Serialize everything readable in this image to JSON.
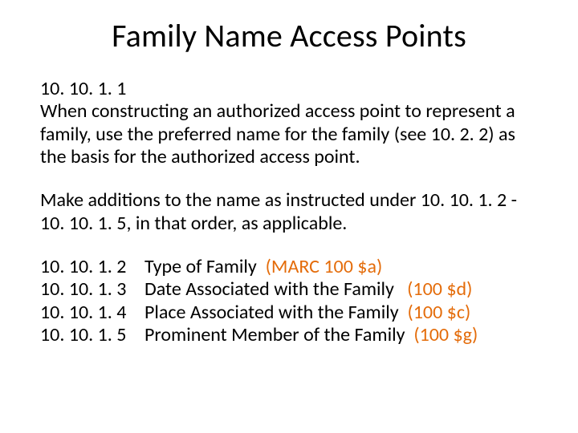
{
  "title": "Family Name Access Points",
  "section1": {
    "rule_number": "10. 10. 1. 1",
    "text": "When constructing an authorized access point to represent a family, use the preferred name for the family (see 10. 2. 2) as the basis for the authorized access point."
  },
  "section2": {
    "text": "Make additions to the name as instructed under 10. 10. 1. 2 - 10. 10. 1. 5, in that order, as applicable."
  },
  "rules": [
    {
      "num": "10. 10. 1. 2",
      "desc": "Type of Family",
      "marc": "(MARC 100 $a)"
    },
    {
      "num": "10. 10. 1. 3",
      "desc": "Date Associated with the Family",
      "marc": "(100 $d)"
    },
    {
      "num": "10. 10. 1. 4",
      "desc": "Place Associated with the Family",
      "marc": "(100 $c)"
    },
    {
      "num": "10. 10. 1. 5",
      "desc": "Prominent Member of the Family",
      "marc": "(100 $g)"
    }
  ]
}
